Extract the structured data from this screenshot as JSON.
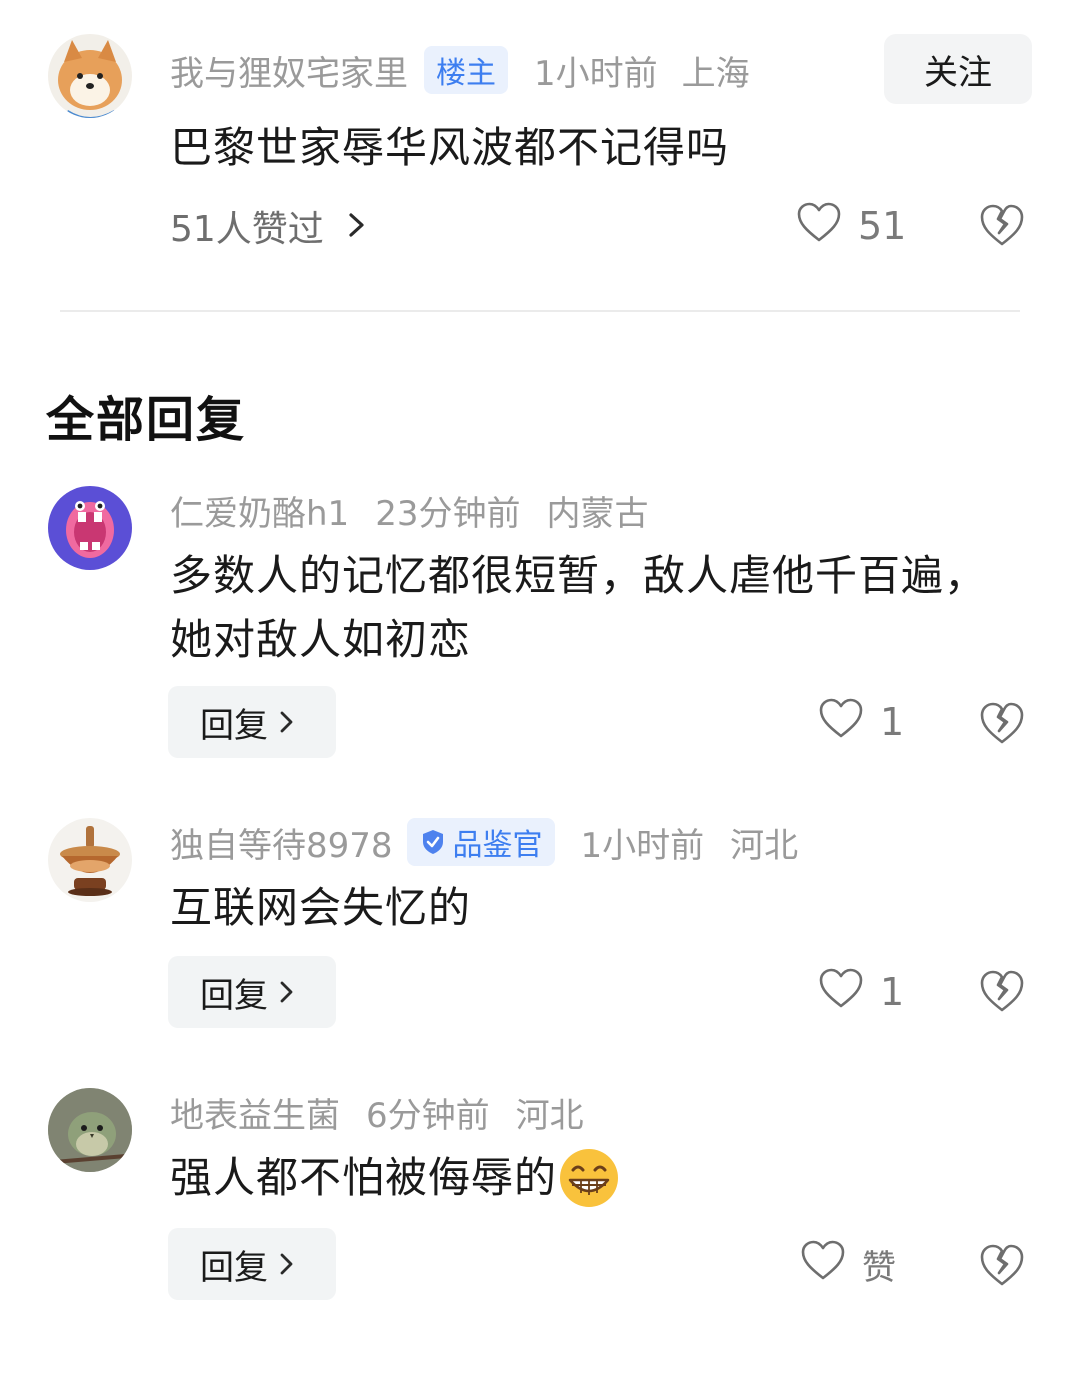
{
  "post": {
    "username": "我与狸奴宅家里",
    "owner_badge": "楼主",
    "time": "1小时前",
    "location": "上海",
    "follow_label": "关注",
    "text": "巴黎世家辱华风波都不记得吗",
    "likers_text": "51人赞过",
    "like_count": "51"
  },
  "section_title": "全部回复",
  "replies": [
    {
      "username": "仁爱奶酪h1",
      "time": "23分钟前",
      "location": "内蒙古",
      "text": "多数人的记忆都很短暂，敌人虐他千百遍，她对敌人如初恋",
      "reply_label": "回复",
      "like_count": "1"
    },
    {
      "username": "独自等待8978",
      "badge": "品鉴官",
      "time": "1小时前",
      "location": "河北",
      "text": "互联网会失忆的",
      "reply_label": "回复",
      "like_count": "1"
    },
    {
      "username": "地表益生菌",
      "time": "6分钟前",
      "location": "河北",
      "text": "强人都不怕被侮辱的",
      "emoji": "grinning-face-icon",
      "reply_label": "回复",
      "like_label": "赞"
    }
  ],
  "colors": {
    "meta_gray": "#9a9a9a",
    "badge_blue": "#3d7ef0",
    "badge_bg": "#eaf1fd",
    "button_bg": "#f2f4f5"
  }
}
